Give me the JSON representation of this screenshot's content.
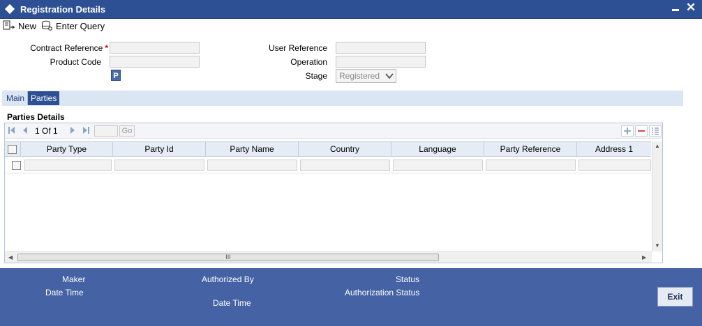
{
  "window": {
    "title": "Registration Details"
  },
  "toolbar": {
    "new_label": "New",
    "enter_query_label": "Enter Query"
  },
  "form": {
    "contract_reference": {
      "label": "Contract Reference",
      "required": "*",
      "value": ""
    },
    "product_code": {
      "label": "Product Code",
      "value": ""
    },
    "p_button_label": "P",
    "user_reference": {
      "label": "User Reference",
      "value": ""
    },
    "operation": {
      "label": "Operation",
      "value": ""
    },
    "stage": {
      "label": "Stage",
      "selected": "Registered"
    }
  },
  "tabs": [
    {
      "label": "Main",
      "active": false
    },
    {
      "label": "Parties",
      "active": true
    }
  ],
  "parties": {
    "title": "Parties Details",
    "pagination": {
      "current": "1",
      "of_label": "Of",
      "total": "1",
      "go_label": "Go"
    },
    "columns": [
      "Party Type",
      "Party Id",
      "Party Name",
      "Country",
      "Language",
      "Party Reference",
      "Address 1"
    ],
    "scrollbar_grip": "III"
  },
  "footer": {
    "maker_label": "Maker",
    "date_time_label": "Date Time",
    "authorized_by_label": "Authorized By",
    "authorized_date_time_label": "Date Time",
    "status_label": "Status",
    "authorization_status_label": "Authorization Status",
    "exit_label": "Exit"
  },
  "colors": {
    "title_bar": "#2d4f93",
    "footer": "#4563a4",
    "tab_active": "#2d4f93",
    "tab_strip": "#dbe6f4"
  }
}
